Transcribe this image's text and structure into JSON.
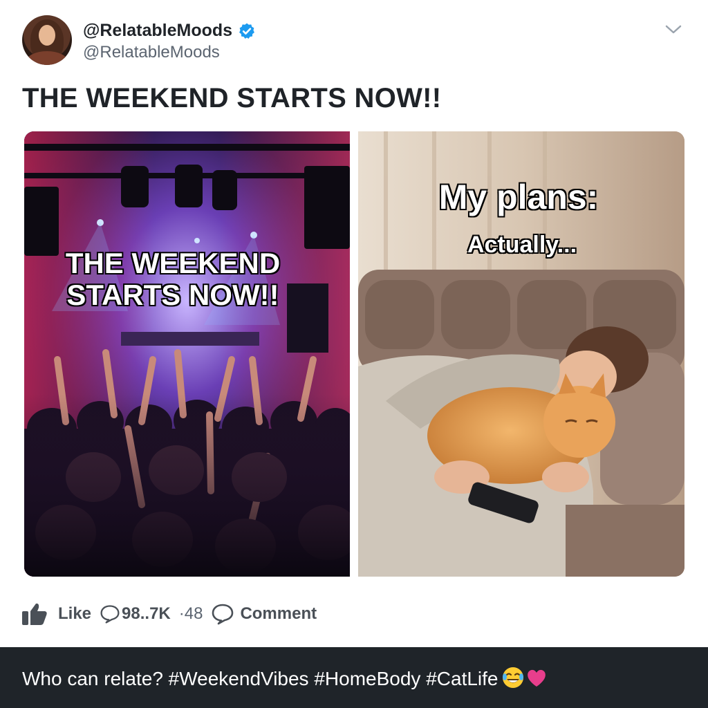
{
  "post": {
    "display_name": "@RelatableMoods",
    "handle": "@RelatableMoods",
    "title": "THE WEEKEND STARTS NOW!!"
  },
  "meme": {
    "left_caption_line1": "THE WEEKEND",
    "left_caption_line2": "STARTS NOW!!",
    "right_caption_1": "My plans:",
    "right_caption_2": "Actually..."
  },
  "actions": {
    "like_label": "Like",
    "reactions_count": "98..7K",
    "separator_count": "·48",
    "comment_label": "Comment"
  },
  "caption": {
    "text": "Who can relate? #WeekendVibes #HomeBody #CatLife"
  },
  "colors": {
    "verified": "#1d9bf0",
    "caption_bar": "#1f2429",
    "heart": "#e83e8c"
  },
  "icons": {
    "verified": "verified-badge-icon",
    "chevron": "chevron-down-icon",
    "like": "thumbs-up-icon",
    "reply": "speech-bubble-icon",
    "comment": "comment-icon"
  }
}
